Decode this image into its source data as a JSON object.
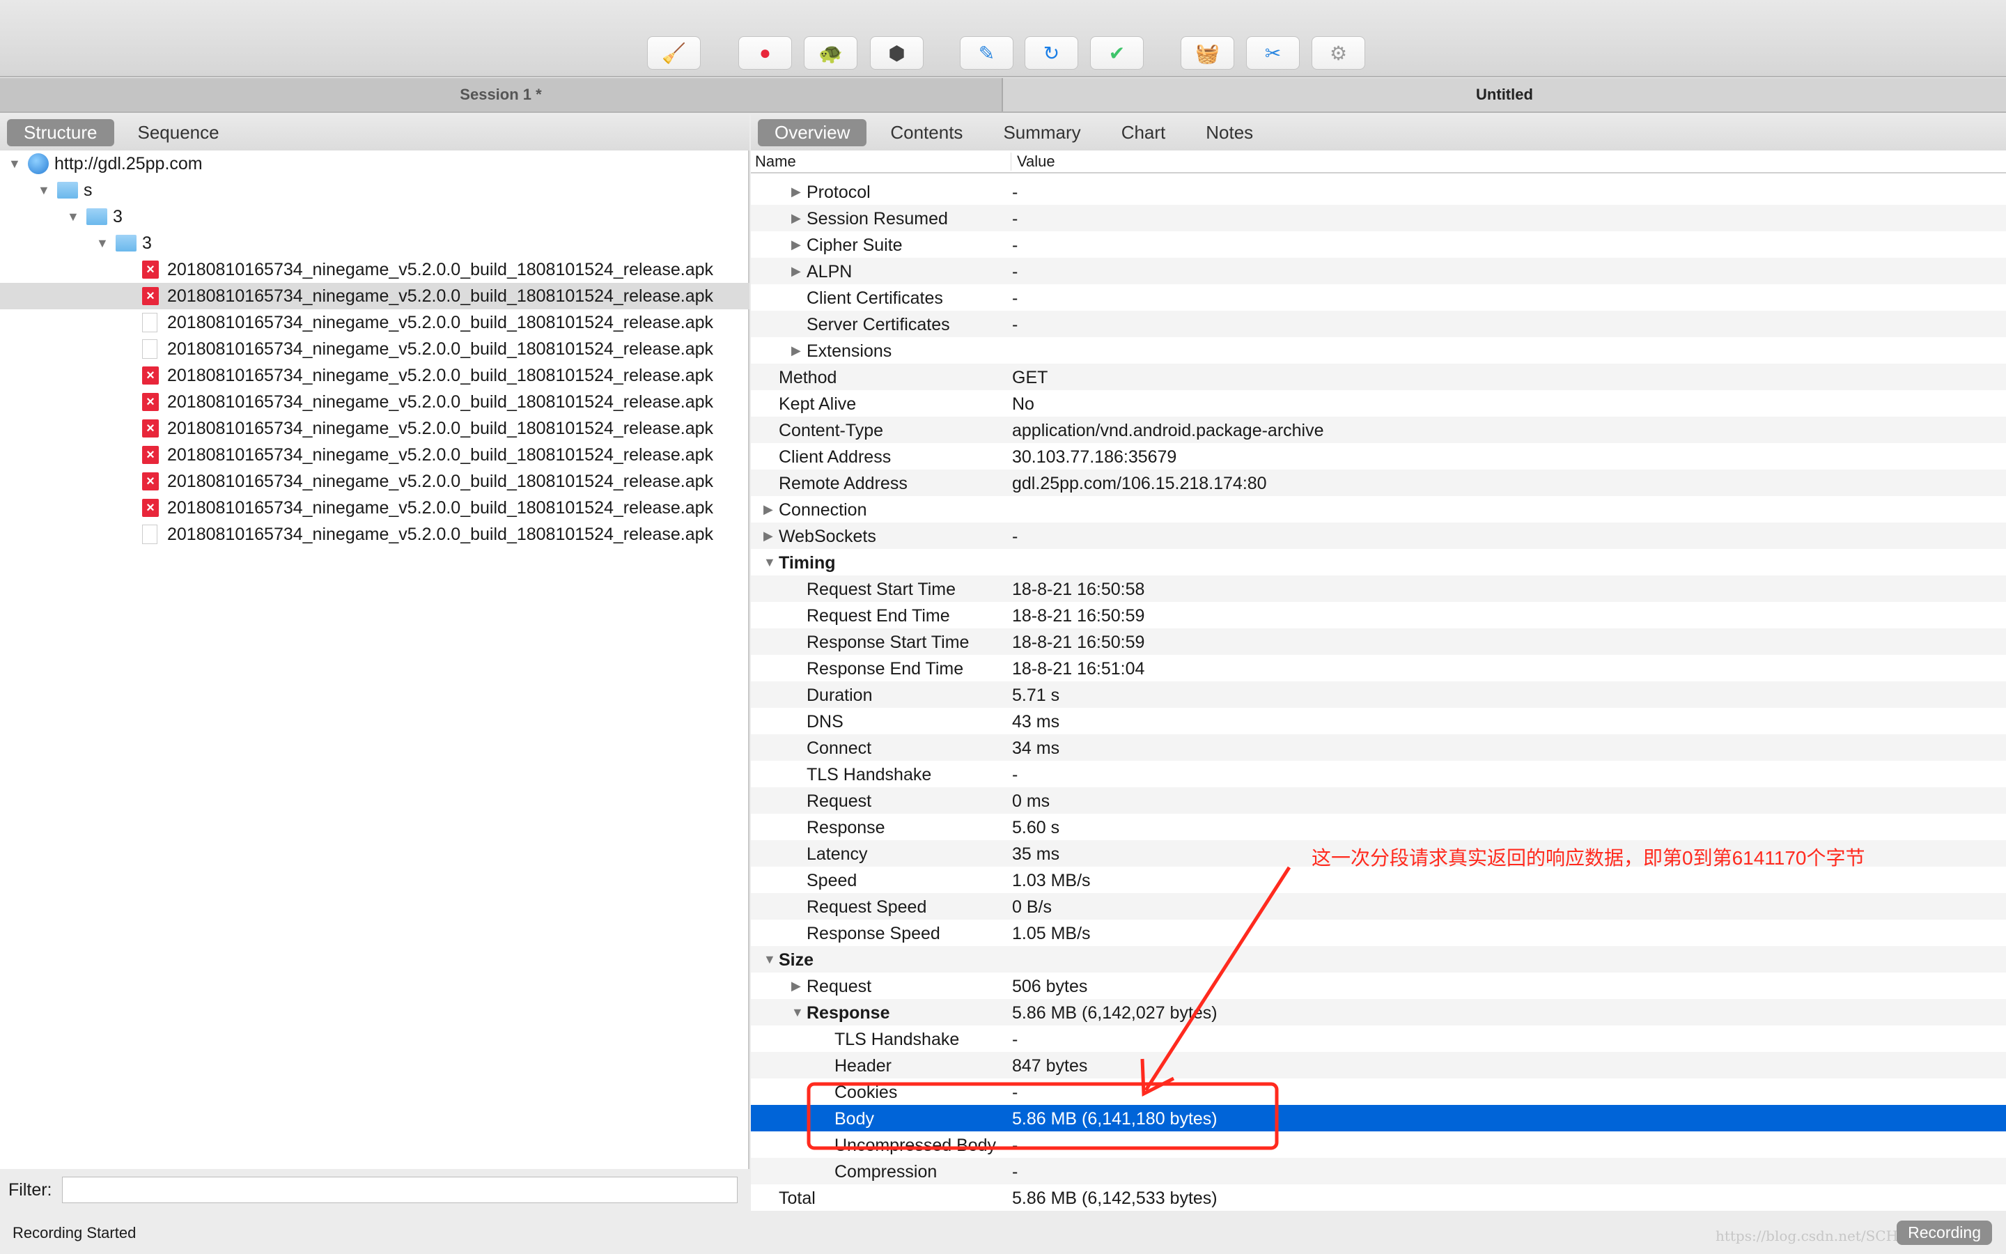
{
  "toolbar": {
    "buttons": [
      {
        "name": "clear-broom",
        "glyph": "🧹",
        "color": "#e8b400"
      },
      {
        "name": "record",
        "glyph": "●",
        "color": "#e8263a"
      },
      {
        "name": "throttle-turtle",
        "glyph": "🐢",
        "color": "#444"
      },
      {
        "name": "stop-hexagon",
        "glyph": "⬢",
        "color": "#444"
      },
      {
        "name": "edit-pen",
        "glyph": "✎",
        "color": "#2a86e0"
      },
      {
        "name": "repeat",
        "glyph": "↻",
        "color": "#1a7ee6"
      },
      {
        "name": "validate-check",
        "glyph": "✔",
        "color": "#3ec46a"
      },
      {
        "name": "basket",
        "glyph": "🧺",
        "color": "#3ec46a"
      },
      {
        "name": "tools",
        "glyph": "✂",
        "color": "#2a86e0"
      },
      {
        "name": "settings-gear",
        "glyph": "⚙",
        "color": "#999"
      }
    ]
  },
  "session": {
    "left_title": "Session 1 *",
    "right_title": "Untitled"
  },
  "left_tabs": [
    {
      "label": "Structure",
      "active": true
    },
    {
      "label": "Sequence",
      "active": false
    }
  ],
  "right_tabs": [
    {
      "label": "Overview",
      "active": true
    },
    {
      "label": "Contents",
      "active": false
    },
    {
      "label": "Summary",
      "active": false
    },
    {
      "label": "Chart",
      "active": false
    },
    {
      "label": "Notes",
      "active": false
    }
  ],
  "tree": [
    {
      "label": "http://gdl.25pp.com",
      "level": 0,
      "icon": "globe",
      "open": true
    },
    {
      "label": "s",
      "level": 1,
      "icon": "folder",
      "open": true
    },
    {
      "label": "3",
      "level": 2,
      "icon": "folder",
      "open": true
    },
    {
      "label": "3",
      "level": 3,
      "icon": "folder",
      "open": true
    },
    {
      "label": "20180810165734_ninegame_v5.2.0.0_build_1808101524_release.apk",
      "level": 4,
      "icon": "error"
    },
    {
      "label": "20180810165734_ninegame_v5.2.0.0_build_1808101524_release.apk",
      "level": 4,
      "icon": "error",
      "selected": true
    },
    {
      "label": "20180810165734_ninegame_v5.2.0.0_build_1808101524_release.apk",
      "level": 4,
      "icon": "doc"
    },
    {
      "label": "20180810165734_ninegame_v5.2.0.0_build_1808101524_release.apk",
      "level": 4,
      "icon": "doc"
    },
    {
      "label": "20180810165734_ninegame_v5.2.0.0_build_1808101524_release.apk",
      "level": 4,
      "icon": "error"
    },
    {
      "label": "20180810165734_ninegame_v5.2.0.0_build_1808101524_release.apk",
      "level": 4,
      "icon": "error"
    },
    {
      "label": "20180810165734_ninegame_v5.2.0.0_build_1808101524_release.apk",
      "level": 4,
      "icon": "error"
    },
    {
      "label": "20180810165734_ninegame_v5.2.0.0_build_1808101524_release.apk",
      "level": 4,
      "icon": "error"
    },
    {
      "label": "20180810165734_ninegame_v5.2.0.0_build_1808101524_release.apk",
      "level": 4,
      "icon": "error"
    },
    {
      "label": "20180810165734_ninegame_v5.2.0.0_build_1808101524_release.apk",
      "level": 4,
      "icon": "error"
    },
    {
      "label": "20180810165734_ninegame_v5.2.0.0_build_1808101524_release.apk",
      "level": 4,
      "icon": "doc"
    }
  ],
  "columns": {
    "name": "Name",
    "value": "Value"
  },
  "rows": [
    {
      "name": "Protocol",
      "value": "-",
      "level": 2,
      "exp": "closed"
    },
    {
      "name": "Session Resumed",
      "value": "-",
      "level": 2,
      "exp": "closed"
    },
    {
      "name": "Cipher Suite",
      "value": "-",
      "level": 2,
      "exp": "closed"
    },
    {
      "name": "ALPN",
      "value": "-",
      "level": 2,
      "exp": "closed"
    },
    {
      "name": "Client Certificates",
      "value": "-",
      "level": 2
    },
    {
      "name": "Server Certificates",
      "value": "-",
      "level": 2
    },
    {
      "name": "Extensions",
      "value": "",
      "level": 2,
      "exp": "closed"
    },
    {
      "name": "Method",
      "value": "GET",
      "level": 1
    },
    {
      "name": "Kept Alive",
      "value": "No",
      "level": 1
    },
    {
      "name": "Content-Type",
      "value": "application/vnd.android.package-archive",
      "level": 1
    },
    {
      "name": "Client Address",
      "value": "30.103.77.186:35679",
      "level": 1
    },
    {
      "name": "Remote Address",
      "value": "gdl.25pp.com/106.15.218.174:80",
      "level": 1
    },
    {
      "name": "Connection",
      "value": "",
      "level": 1,
      "exp": "closed"
    },
    {
      "name": "WebSockets",
      "value": "-",
      "level": 1,
      "exp": "closed"
    },
    {
      "name": "Timing",
      "value": "",
      "level": 1,
      "exp": "open",
      "bold": true
    },
    {
      "name": "Request Start Time",
      "value": "18-8-21 16:50:58",
      "level": 2
    },
    {
      "name": "Request End Time",
      "value": "18-8-21 16:50:59",
      "level": 2
    },
    {
      "name": "Response Start Time",
      "value": "18-8-21 16:50:59",
      "level": 2
    },
    {
      "name": "Response End Time",
      "value": "18-8-21 16:51:04",
      "level": 2
    },
    {
      "name": "Duration",
      "value": "5.71 s",
      "level": 2
    },
    {
      "name": "DNS",
      "value": "43 ms",
      "level": 2
    },
    {
      "name": "Connect",
      "value": "34 ms",
      "level": 2
    },
    {
      "name": "TLS Handshake",
      "value": "-",
      "level": 2
    },
    {
      "name": "Request",
      "value": "0 ms",
      "level": 2
    },
    {
      "name": "Response",
      "value": "5.60 s",
      "level": 2
    },
    {
      "name": "Latency",
      "value": "35 ms",
      "level": 2
    },
    {
      "name": "Speed",
      "value": "1.03 MB/s",
      "level": 2
    },
    {
      "name": "Request Speed",
      "value": "0 B/s",
      "level": 2
    },
    {
      "name": "Response Speed",
      "value": "1.05 MB/s",
      "level": 2
    },
    {
      "name": "Size",
      "value": "",
      "level": 1,
      "exp": "open",
      "bold": true
    },
    {
      "name": "Request",
      "value": "506 bytes",
      "level": 2,
      "exp": "closed"
    },
    {
      "name": "Response",
      "value": "5.86 MB (6,142,027 bytes)",
      "level": 2,
      "exp": "open",
      "bold": true
    },
    {
      "name": "TLS Handshake",
      "value": "-",
      "level": 3
    },
    {
      "name": "Header",
      "value": "847 bytes",
      "level": 3
    },
    {
      "name": "Cookies",
      "value": "-",
      "level": 3
    },
    {
      "name": "Body",
      "value": "5.86 MB (6,141,180 bytes)",
      "level": 3,
      "selected": true
    },
    {
      "name": "Uncompressed Body",
      "value": "-",
      "level": 3
    },
    {
      "name": "Compression",
      "value": "-",
      "level": 3
    },
    {
      "name": "Total",
      "value": "5.86 MB (6,142,533 bytes)",
      "level": 1
    }
  ],
  "filter": {
    "label": "Filter:",
    "value": ""
  },
  "status": {
    "text": "Recording Started",
    "badge": "Recording"
  },
  "watermark": "https://blog.csdn.net/SCHOLAR_II",
  "annotation": {
    "text": "这一次分段请求真实返回的响应数据，即第0到第6141170个字节",
    "color": "#ff2a1e"
  },
  "colors": {
    "selection": "#0064d8",
    "tab_active": "#8e8e8e",
    "error_icon": "#e8263a"
  }
}
